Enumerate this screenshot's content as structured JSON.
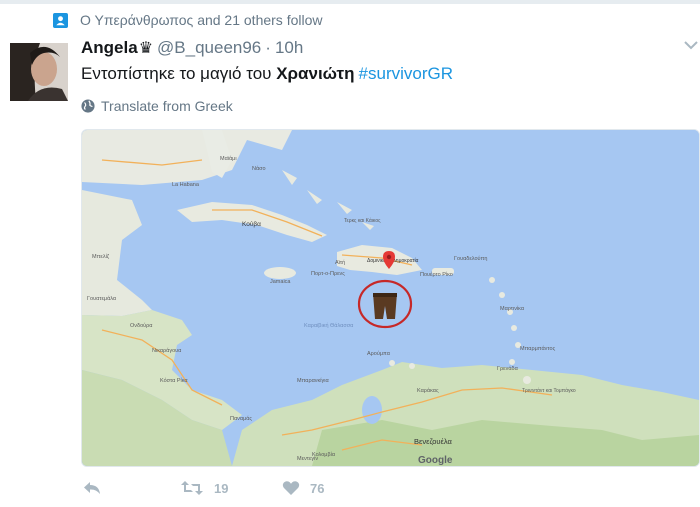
{
  "social_context": {
    "text": "Ο Υπεράνθρωπος and 21 others follow"
  },
  "tweet": {
    "author_name": "Angela",
    "author_badge": "♛",
    "handle": "@B_queen96",
    "separator": "·",
    "time": "10h",
    "text_before": "Εντοπίστηκε το μαγιό του ",
    "text_bold": "Χρανιώτη",
    "hashtag": "#survivorGR",
    "translate_label": "Translate from Greek"
  },
  "map": {
    "brand": "Google",
    "labels": {
      "la_havana": "La Habana",
      "cuba": "Κούβα",
      "jamaica": "Jamaica",
      "haiti": "Αϊτή",
      "dominican": "Δομινικανή Δημοκρατία",
      "port_au_prince": "Πορτ-ο-Πρενς",
      "puerto_rico": "Πουέρτο Ρίκο",
      "caribbean_sea": "Καραϊβική Θάλασσα",
      "venezuela": "Βενεζουέλα",
      "honduras": "Ονδούρα",
      "nicaragua": "Νικαράγουα",
      "costa_rica": "Κόστα Ρίκα",
      "panama": "Παναμάς",
      "aruba": "Αρούμπα",
      "caracas": "Καράκας",
      "colombia": "Κολομβία",
      "belize": "Μπελίζ",
      "guatemala": "Γουατεμάλα",
      "bahamas": "Νάσο",
      "turks": "Τερκς και Κάικος",
      "martinique": "Μαρτινίκα",
      "barbados": "Μπαρμπάντος",
      "trinidad": "Τρινιντάντ και Τομπάγκο",
      "grenada": "Γρενάδα",
      "guadeloupe": "Γουαδελούπη",
      "miami": "Μαϊάμι",
      "medellin": "Μεντεγίν",
      "barranquilla": "Μπαρανκίγια"
    }
  },
  "actions": {
    "retweet_count": "19",
    "like_count": "76"
  },
  "colors": {
    "accent": "#1b95e0",
    "muted": "#657786",
    "icon": "#aab8c2",
    "like": "#aab8c2"
  }
}
